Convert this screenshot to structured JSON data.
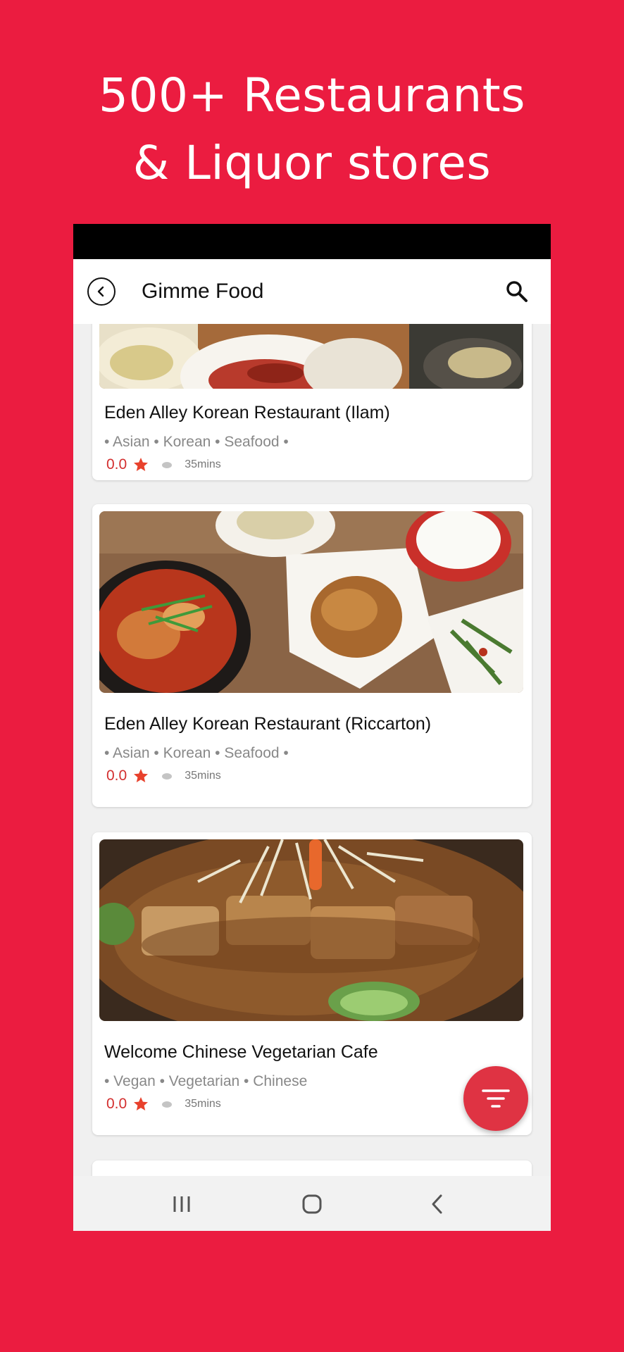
{
  "promo": {
    "line1": "500+ Restaurants",
    "line2": "& Liquor stores"
  },
  "appbar": {
    "back_icon": "back-circle-icon",
    "title": "Gimme Food",
    "search_icon": "search-icon"
  },
  "restaurants": [
    {
      "name": "Eden Alley Korean Restaurant (Ilam)",
      "tags": "• Asian • Korean • Seafood •",
      "rating": "0.0",
      "time": "35mins"
    },
    {
      "name": "Eden Alley Korean Restaurant (Riccarton)",
      "tags": "• Asian • Korean • Seafood •",
      "rating": "0.0",
      "time": "35mins"
    },
    {
      "name": "Welcome Chinese Vegetarian Cafe",
      "tags": "• Vegan •  Vegetarian • Chinese",
      "rating": "0.0",
      "time": "35mins"
    }
  ],
  "fab": {
    "icon": "filter-icon"
  },
  "navbar": {
    "recents_icon": "recents-icon",
    "home_icon": "home-icon",
    "back_icon": "back-chevron-icon"
  },
  "colors": {
    "brand_red": "#EB1C40",
    "fab_red": "#DF3343",
    "rating_red": "#D32F2F",
    "star_red": "#E8412C"
  }
}
